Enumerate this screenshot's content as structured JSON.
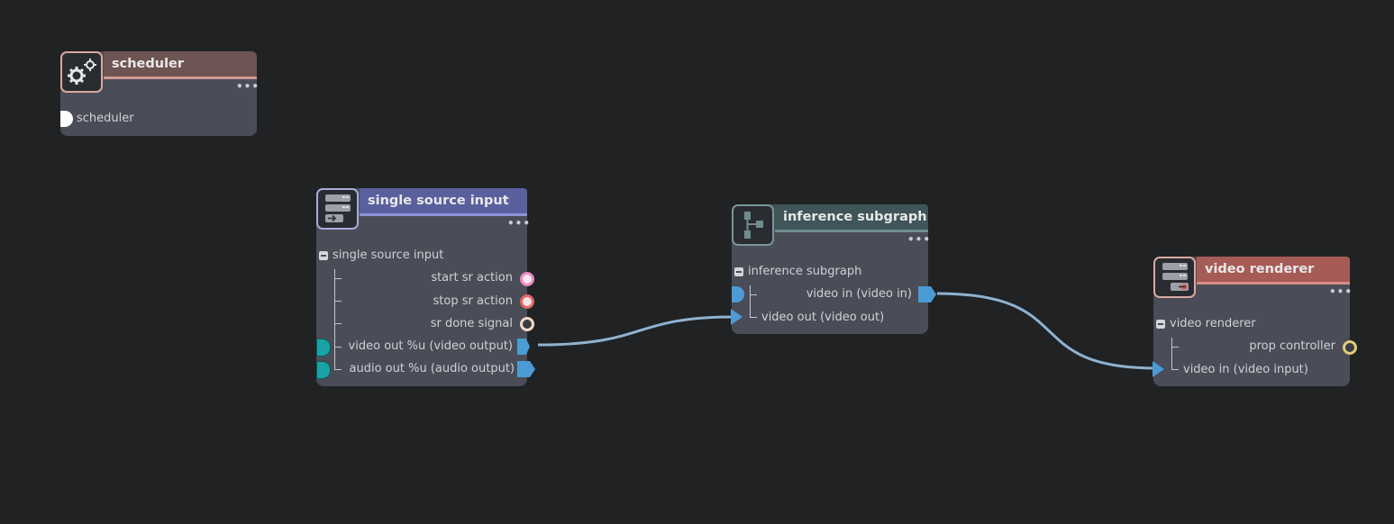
{
  "colors": {
    "background": "#212223",
    "node_body": "#4a4d57",
    "wire": "#8fb3d1",
    "port_blue": "#4a9bd6",
    "port_teal": "#1aa3a6"
  },
  "nodes": {
    "scheduler": {
      "title": "scheduler",
      "icon": "gears-icon",
      "rows": {
        "scheduler": "scheduler"
      },
      "more": "•••"
    },
    "single_source_input": {
      "title": "single source input",
      "icon": "source-stack-icon",
      "more": "•••",
      "group": "single source input",
      "rows": {
        "start": "start sr action",
        "stop": "stop sr action",
        "done": "sr done signal",
        "video_out": "video out %u (video output)",
        "audio_out": "audio out %u (audio output)"
      }
    },
    "inference_subgraph": {
      "title": "inference subgraph",
      "icon": "subgraph-icon",
      "more": "•••",
      "group": "inference subgraph",
      "rows": {
        "video_in": "video in (video in)",
        "video_out": "video out (video out)"
      }
    },
    "video_renderer": {
      "title": "video renderer",
      "icon": "renderer-stack-icon",
      "more": "•••",
      "group": "video renderer",
      "rows": {
        "prop_controller": "prop controller",
        "video_in": "video in (video input)"
      }
    }
  }
}
